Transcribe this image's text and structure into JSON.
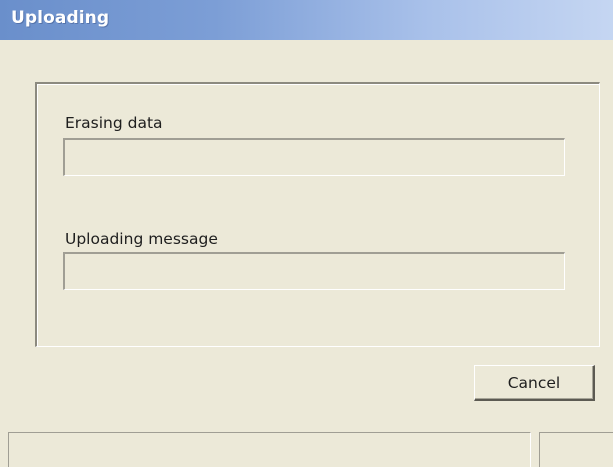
{
  "window": {
    "title": "Uploading"
  },
  "erasing": {
    "label": "Erasing data",
    "progress_percent": 0
  },
  "uploading": {
    "label": "Uploading message",
    "progress_percent": 0
  },
  "buttons": {
    "cancel_label": "Cancel"
  },
  "status_bar": {
    "main_text": "",
    "side_text": ""
  },
  "colors": {
    "title_bar_start": "#6a8fcb",
    "title_bar_end": "#c5d6f2",
    "window_background": "#ece9d8",
    "progress_fill": "#3169c6"
  }
}
